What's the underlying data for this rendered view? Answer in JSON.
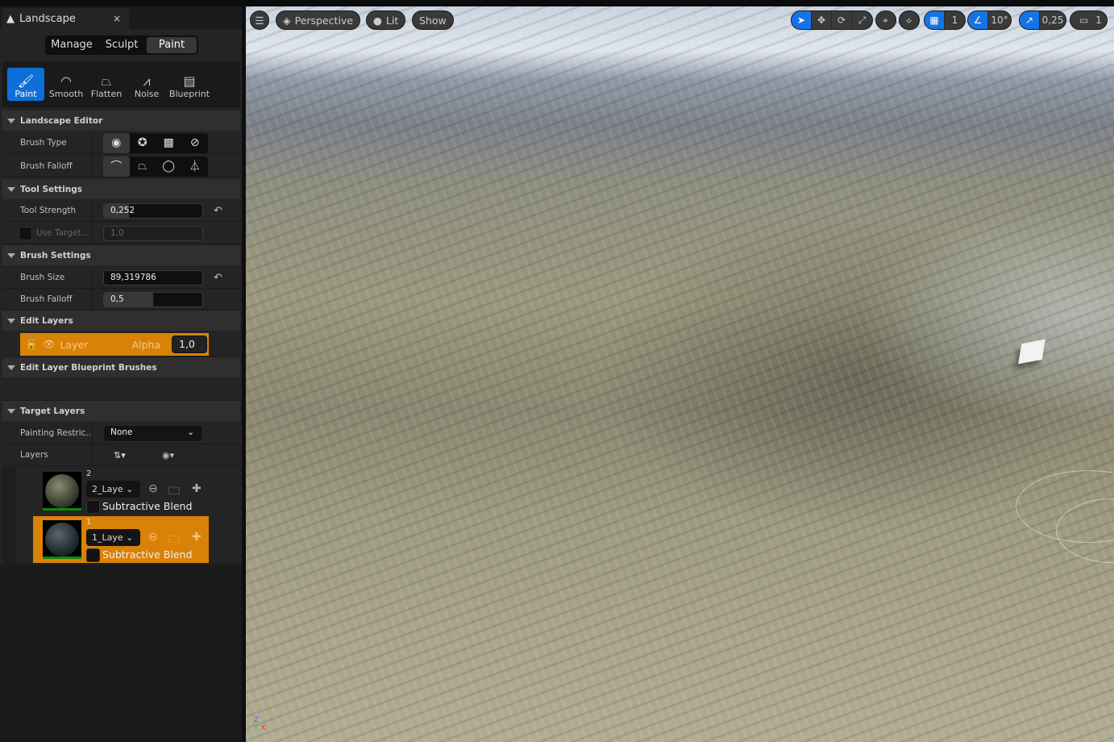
{
  "panel": {
    "title": "Landscape",
    "close": "×",
    "modes": [
      "Manage",
      "Sculpt",
      "Paint"
    ],
    "active_mode": "Paint",
    "tools": [
      {
        "label": "Paint",
        "icon": "brush-icon"
      },
      {
        "label": "Smooth",
        "icon": "smooth-icon"
      },
      {
        "label": "Flatten",
        "icon": "flatten-icon"
      },
      {
        "label": "Noise",
        "icon": "noise-icon"
      },
      {
        "label": "Blueprint",
        "icon": "blueprint-icon"
      }
    ],
    "sections": {
      "landscape_editor": "Landscape Editor",
      "tool_settings": "Tool Settings",
      "brush_settings": "Brush Settings",
      "edit_layers": "Edit Layers",
      "edit_layer_bp": "Edit Layer Blueprint Brushes",
      "target_layers": "Target Layers"
    },
    "brush_type_label": "Brush Type",
    "brush_falloff_type_label": "Brush Falloff",
    "tool_strength": {
      "label": "Tool Strength",
      "value": "0,252",
      "fraction": 0.252
    },
    "use_target": {
      "label": "Use Target...",
      "value": "1,0"
    },
    "brush_size": {
      "label": "Brush Size",
      "value": "89,319786"
    },
    "brush_falloff": {
      "label": "Brush Falloff",
      "value": "0,5",
      "fraction": 0.5
    },
    "edit_layer": {
      "name": "Layer",
      "alpha_label": "Alpha",
      "alpha": "1,0"
    },
    "painting_restriction": {
      "label": "Painting Restric...",
      "value": "None"
    },
    "layers_label": "Layers",
    "layers": [
      {
        "index": "2",
        "name": "2_Laye",
        "blend": "Subtractive Blend",
        "selected": false
      },
      {
        "index": "1",
        "name": "1_Laye",
        "blend": "Subtractive Blend",
        "selected": true
      }
    ]
  },
  "viewport": {
    "perspective": "Perspective",
    "lit": "Lit",
    "show": "Show",
    "grid": "1",
    "angle": "10°",
    "scale": "0,25",
    "camera": "1"
  },
  "colors": {
    "accent": "#1673e6",
    "selection": "#d98208"
  }
}
